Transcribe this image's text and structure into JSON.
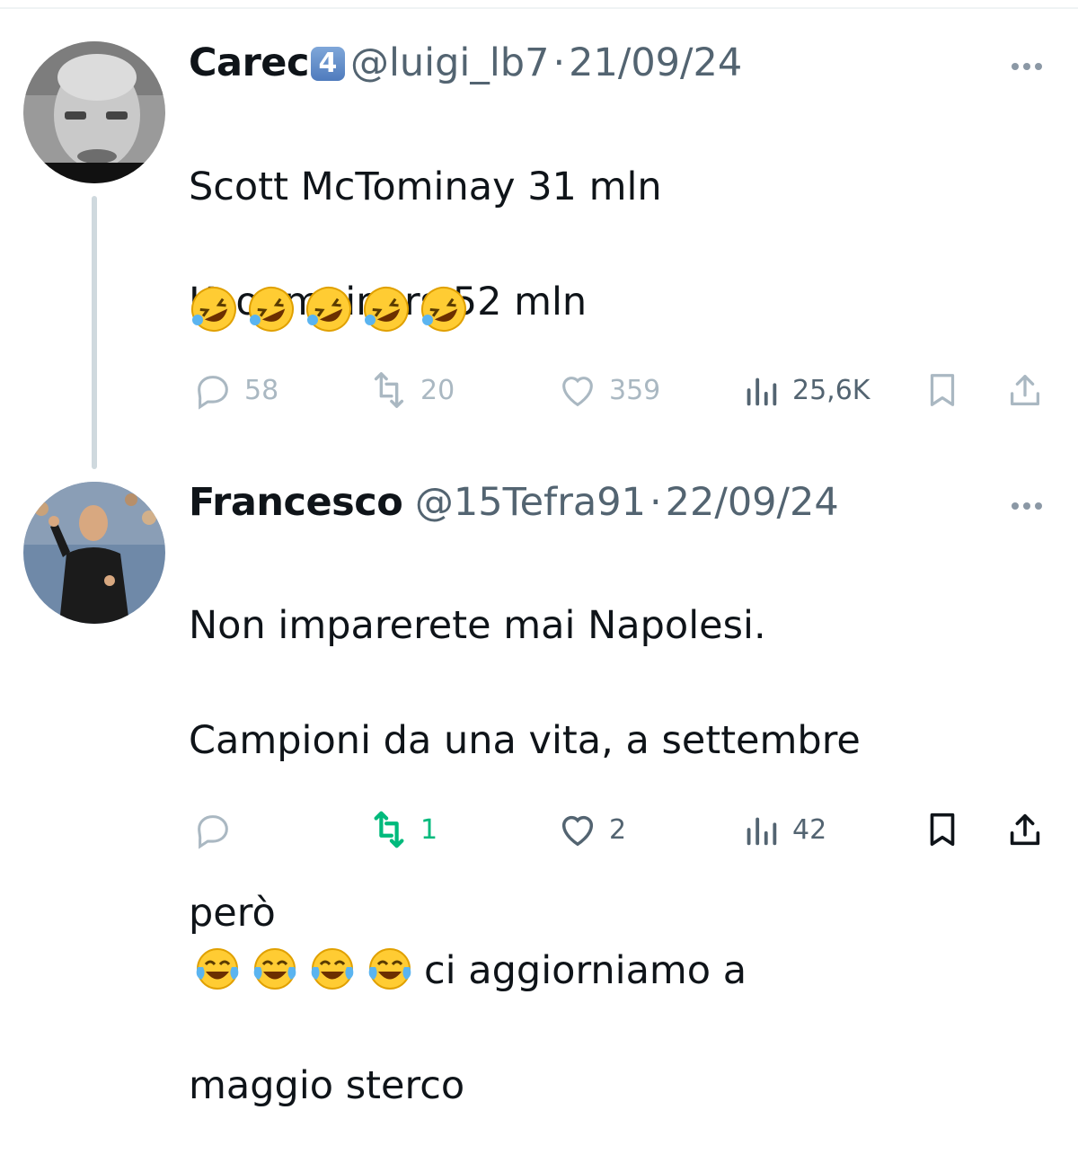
{
  "tweets": [
    {
      "display_name": "Carec",
      "badge": "4",
      "handle": "@luigi_lb7",
      "separator": "·",
      "date": "21/09/24",
      "text_lines": [
        "Scott McTominay 31 mln",
        "Koopmeiners 52 mln"
      ],
      "emoji_row": [
        "rolling-on-floor-laughing",
        "rolling-on-floor-laughing",
        "rolling-on-floor-laughing",
        "rolling-on-floor-laughing",
        "rolling-on-floor-laughing"
      ],
      "actions": {
        "replies": "58",
        "reposts": "20",
        "likes": "359",
        "views": "25,6K"
      }
    },
    {
      "display_name": "Francesco",
      "handle": "@15Tefra91",
      "separator": "·",
      "date": "22/09/24",
      "text_line1": "Non imparerete mai Napolesi.",
      "text_line2": "Campioni da una vita, a settembre",
      "text_line3_before": "però",
      "text_line3_after": "ci aggiorniamo a",
      "text_line4": "maggio sterco",
      "inline_emojis": [
        "face-with-tears-of-joy",
        "face-with-tears-of-joy",
        "face-with-tears-of-joy",
        "face-with-tears-of-joy"
      ],
      "actions": {
        "replies": "",
        "reposts": "1",
        "likes": "2",
        "views": "42"
      }
    }
  ],
  "icons": [
    "reply-icon",
    "repost-icon",
    "like-icon",
    "views-icon",
    "bookmark-icon",
    "share-icon",
    "more-icon"
  ],
  "colors": {
    "text": "#0f1419",
    "secondary": "#536471",
    "muted_icon": "#aab8c2",
    "repost_active": "#00ba7c",
    "thread_line": "#cfd9de"
  }
}
